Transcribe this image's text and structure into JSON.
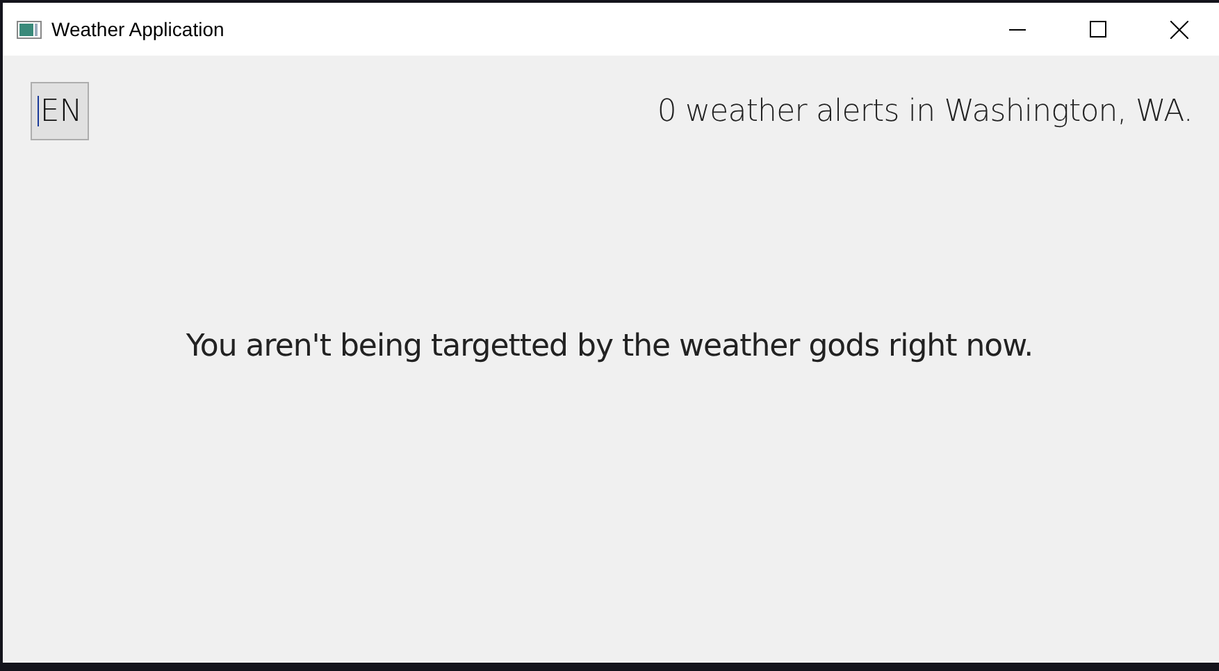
{
  "window": {
    "title": "Weather Application"
  },
  "language_field": {
    "value": "EN",
    "focused": true
  },
  "alert_summary": "0 weather alerts in Washington, WA.",
  "message": "You aren't being targetted by the weather gods right now."
}
